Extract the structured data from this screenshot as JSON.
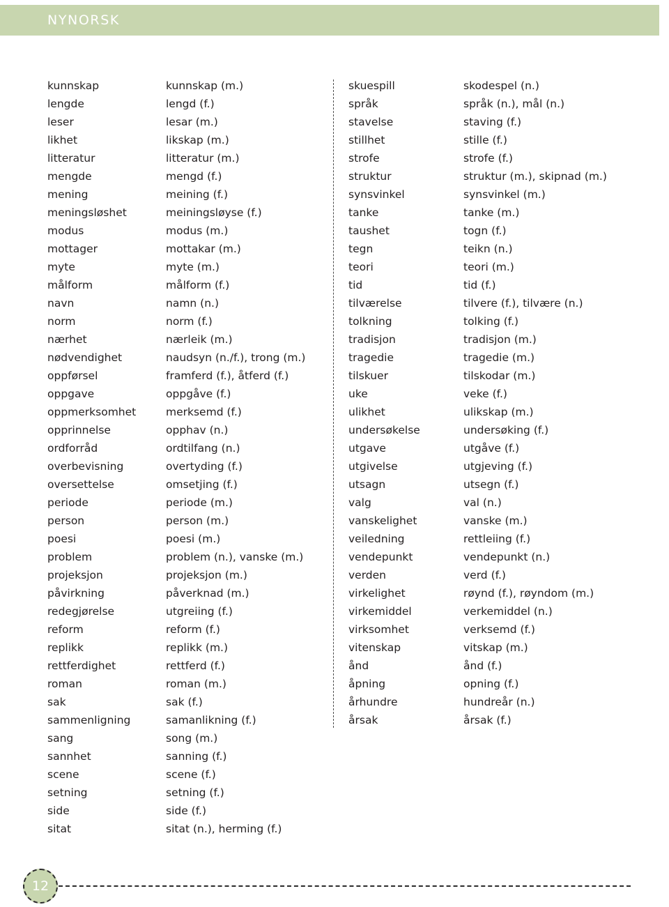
{
  "header": {
    "title": "NYNORSK",
    "bar_color": "#c8d6af"
  },
  "footer": {
    "page_number": "12"
  },
  "columns": {
    "left": [
      {
        "term": "kunnskap",
        "gloss": "kunnskap (m.)"
      },
      {
        "term": "lengde",
        "gloss": "lengd (f.)"
      },
      {
        "term": "leser",
        "gloss": "lesar (m.)"
      },
      {
        "term": "likhet",
        "gloss": "likskap (m.)"
      },
      {
        "term": "litteratur",
        "gloss": "litteratur (m.)"
      },
      {
        "term": "mengde",
        "gloss": "mengd (f.)"
      },
      {
        "term": "mening",
        "gloss": "meining (f.)"
      },
      {
        "term": "meningsløshet",
        "gloss": "meiningsløyse (f.)"
      },
      {
        "term": "modus",
        "gloss": "modus (m.)"
      },
      {
        "term": "mottager",
        "gloss": "mottakar (m.)"
      },
      {
        "term": "myte",
        "gloss": "myte (m.)"
      },
      {
        "term": "målform",
        "gloss": "målform (f.)"
      },
      {
        "term": "navn",
        "gloss": "namn (n.)"
      },
      {
        "term": "norm",
        "gloss": "norm (f.)"
      },
      {
        "term": "nærhet",
        "gloss": "nærleik (m.)"
      },
      {
        "term": "nødvendighet",
        "gloss": "naudsyn (n./f.), trong (m.)"
      },
      {
        "term": "oppførsel",
        "gloss": "framferd (f.), åtferd (f.)"
      },
      {
        "term": "oppgave",
        "gloss": "oppgåve (f.)"
      },
      {
        "term": "oppmerksomhet",
        "gloss": "merksemd (f.)"
      },
      {
        "term": "opprinnelse",
        "gloss": "opphav (n.)"
      },
      {
        "term": "ordforråd",
        "gloss": "ordtilfang (n.)"
      },
      {
        "term": "overbevisning",
        "gloss": "overtyding (f.)"
      },
      {
        "term": "oversettelse",
        "gloss": "omsetjing (f.)"
      },
      {
        "term": "periode",
        "gloss": "periode (m.)"
      },
      {
        "term": "person",
        "gloss": "person (m.)"
      },
      {
        "term": "poesi",
        "gloss": "poesi (m.)"
      },
      {
        "term": "problem",
        "gloss": "problem (n.), vanske (m.)"
      },
      {
        "term": "projeksjon",
        "gloss": "projeksjon (m.)"
      },
      {
        "term": "påvirkning",
        "gloss": "påverknad (m.)"
      },
      {
        "term": "redegjørelse",
        "gloss": "utgreiing (f.)"
      },
      {
        "term": "reform",
        "gloss": "reform (f.)"
      },
      {
        "term": "replikk",
        "gloss": "replikk (m.)"
      },
      {
        "term": "rettferdighet",
        "gloss": "rettferd (f.)"
      },
      {
        "term": "roman",
        "gloss": "roman (m.)"
      },
      {
        "term": "sak",
        "gloss": "sak (f.)"
      },
      {
        "term": "sammenligning",
        "gloss": "samanlikning (f.)"
      },
      {
        "term": "sang",
        "gloss": "song (m.)"
      },
      {
        "term": "sannhet",
        "gloss": "sanning (f.)"
      },
      {
        "term": "scene",
        "gloss": "scene (f.)"
      },
      {
        "term": "setning",
        "gloss": "setning (f.)"
      },
      {
        "term": "side",
        "gloss": "side (f.)"
      },
      {
        "term": "sitat",
        "gloss": "sitat (n.), herming (f.)"
      }
    ],
    "right": [
      {
        "term": "skuespill",
        "gloss": "skodespel (n.)"
      },
      {
        "term": "språk",
        "gloss": "språk (n.), mål (n.)"
      },
      {
        "term": "stavelse",
        "gloss": "staving (f.)"
      },
      {
        "term": "stillhet",
        "gloss": "stille (f.)"
      },
      {
        "term": "strofe",
        "gloss": "strofe (f.)"
      },
      {
        "term": "struktur",
        "gloss": "struktur (m.), skipnad (m.)"
      },
      {
        "term": "synsvinkel",
        "gloss": "synsvinkel (m.)"
      },
      {
        "term": "tanke",
        "gloss": "tanke (m.)"
      },
      {
        "term": "taushet",
        "gloss": "togn (f.)"
      },
      {
        "term": "tegn",
        "gloss": "teikn (n.)"
      },
      {
        "term": "teori",
        "gloss": "teori (m.)"
      },
      {
        "term": "tid",
        "gloss": "tid (f.)"
      },
      {
        "term": "tilværelse",
        "gloss": "tilvere (f.), tilvære (n.)"
      },
      {
        "term": "tolkning",
        "gloss": "tolking (f.)"
      },
      {
        "term": "tradisjon",
        "gloss": "tradisjon (m.)"
      },
      {
        "term": "tragedie",
        "gloss": "tragedie (m.)"
      },
      {
        "term": "tilskuer",
        "gloss": "tilskodar (m.)"
      },
      {
        "term": "uke",
        "gloss": "veke (f.)"
      },
      {
        "term": "ulikhet",
        "gloss": "ulikskap (m.)"
      },
      {
        "term": "undersøkelse",
        "gloss": "undersøking (f.)"
      },
      {
        "term": "utgave",
        "gloss": "utgåve (f.)"
      },
      {
        "term": "utgivelse",
        "gloss": "utgjeving (f.)"
      },
      {
        "term": "utsagn",
        "gloss": "utsegn (f.)"
      },
      {
        "term": "valg",
        "gloss": "val (n.)"
      },
      {
        "term": "vanskelighet",
        "gloss": "vanske (m.)"
      },
      {
        "term": "veiledning",
        "gloss": "rettleiing (f.)"
      },
      {
        "term": "vendepunkt",
        "gloss": "vendepunkt (n.)"
      },
      {
        "term": "verden",
        "gloss": "verd (f.)"
      },
      {
        "term": "virkelighet",
        "gloss": "røynd (f.), røyndom (m.)"
      },
      {
        "term": "virkemiddel",
        "gloss": "verkemiddel (n.)"
      },
      {
        "term": "virksomhet",
        "gloss": "verksemd (f.)"
      },
      {
        "term": "vitenskap",
        "gloss": "vitskap (m.)"
      },
      {
        "term": "ånd",
        "gloss": "ånd (f.)"
      },
      {
        "term": "åpning",
        "gloss": "opning (f.)"
      },
      {
        "term": "århundre",
        "gloss": "hundreår (n.)"
      },
      {
        "term": "årsak",
        "gloss": "årsak (f.)"
      }
    ]
  }
}
